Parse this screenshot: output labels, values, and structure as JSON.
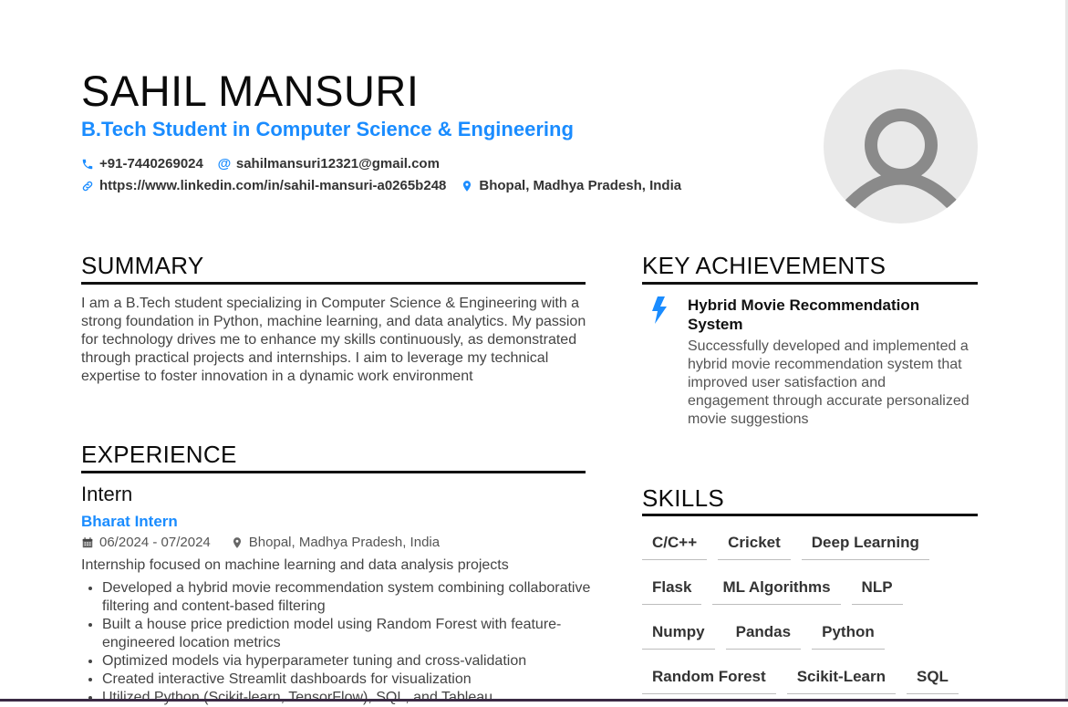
{
  "header": {
    "name": "SAHIL MANSURI",
    "subtitle": "B.Tech Student in Computer Science & Engineering",
    "phone": "+91-7440269024",
    "email": "sahilmansuri12321@gmail.com",
    "linkedin": "https://www.linkedin.com/in/sahil-mansuri-a0265b248",
    "location": "Bhopal, Madhya Pradesh, India"
  },
  "summary": {
    "title": "SUMMARY",
    "text": "I am a B.Tech student specializing in Computer Science & Engineering with a strong foundation in Python, machine learning, and data analytics. My passion for technology drives me to enhance my skills continuously, as demonstrated through practical projects and internships. I aim to leverage my technical expertise to foster innovation in a dynamic work environment"
  },
  "experience": {
    "title": "EXPERIENCE",
    "role": "Intern",
    "company": "Bharat Intern",
    "dates": "06/2024 - 07/2024",
    "location": "Bhopal, Madhya Pradesh, India",
    "description": "Internship focused on machine learning and data analysis projects",
    "bullets": [
      "Developed a hybrid movie recommendation system combining collaborative filtering and content-based filtering",
      "Built a house price prediction model using Random Forest with feature-engineered location metrics",
      "Optimized models via hyperparameter tuning and cross-validation",
      "Created interactive Streamlit dashboards for visualization",
      "Utilized Python (Scikit-learn, TensorFlow), SQL, and Tableau"
    ]
  },
  "achievements": {
    "title": "KEY ACHIEVEMENTS",
    "item_title": "Hybrid Movie Recommendation System",
    "item_text": "Successfully developed and implemented a hybrid movie recommendation system that improved user satisfaction and engagement through accurate personalized movie suggestions"
  },
  "skills": {
    "title": "SKILLS",
    "items": [
      "C/C++",
      "Cricket",
      "Deep Learning",
      "Flask",
      "ML Algorithms",
      "NLP",
      "Numpy",
      "Pandas",
      "Python",
      "Random Forest",
      "Scikit-Learn",
      "SQL"
    ]
  },
  "colors": {
    "accent": "#1a8cff",
    "text": "#111111",
    "muted": "#444444"
  }
}
